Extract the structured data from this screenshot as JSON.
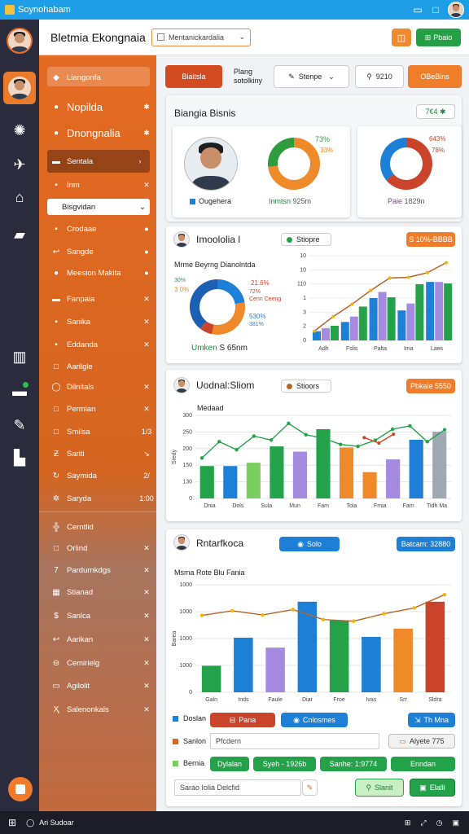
{
  "window": {
    "title": "Soynohabam",
    "icons": [
      "window-logo-icon",
      "minimize-icon",
      "maximize-icon",
      "avatar"
    ]
  },
  "rail": {
    "icons": [
      "avatar",
      "profile-active-icon",
      "globe-icon",
      "satellite-icon",
      "home-icon",
      "chat-icon",
      "barcode-icon",
      "inbox-icon",
      "wrench-icon",
      "analytics-icon",
      "record-icon"
    ]
  },
  "header": {
    "title": "Bletmia Ekongnaia",
    "select_value": "Mentanickardalia",
    "icon_name": "toggle-icon",
    "action_label": "Pbaio"
  },
  "sidebar": {
    "items": [
      {
        "icon": "◆",
        "label": "Liangonfa",
        "right": ""
      },
      {
        "icon": "●",
        "label": "Nopilda",
        "right": "✱"
      },
      {
        "icon": "●",
        "label": "Dnongnalia",
        "right": "✱"
      },
      {
        "icon": "▬",
        "label": "Sentala",
        "right": "›"
      },
      {
        "icon": "▪",
        "label": "Inm",
        "right": "✕"
      },
      {
        "icon": "",
        "label": "Bisgvidan",
        "right": "⌄"
      },
      {
        "icon": "▪",
        "label": "Crodaae",
        "right": "●"
      },
      {
        "icon": "↩",
        "label": "Sangde",
        "right": "●"
      },
      {
        "icon": "●",
        "label": "Meesion Makita",
        "right": "●"
      },
      {
        "icon": "▬",
        "label": "Fanpaia",
        "right": "✕"
      },
      {
        "icon": "▪",
        "label": "Sanika",
        "right": "✕"
      },
      {
        "icon": "▪",
        "label": "Eddanda",
        "right": "✕"
      },
      {
        "icon": "□",
        "label": "Aarilgle",
        "right": ""
      },
      {
        "icon": "◯",
        "label": "Dilnitals",
        "right": "✕"
      },
      {
        "icon": "□",
        "label": "Permian",
        "right": "✕"
      },
      {
        "icon": "□",
        "label": "Smilsa",
        "right": "1/3"
      },
      {
        "icon": "Ƶ",
        "label": "Sariti",
        "right": "↘"
      },
      {
        "icon": "↻",
        "label": "Saymida",
        "right": "2/"
      },
      {
        "icon": "✲",
        "label": "Saryda",
        "right": "1:00"
      },
      {
        "icon": "╬",
        "label": "Cerntlid",
        "right": ""
      },
      {
        "icon": "□",
        "label": "Orlind",
        "right": "✕"
      },
      {
        "icon": "7",
        "label": "Pardurnkdgs",
        "right": "✕"
      },
      {
        "icon": "▦",
        "label": "Stianad",
        "right": "✕"
      },
      {
        "icon": "$",
        "label": "Sanlca",
        "right": "✕"
      },
      {
        "icon": "↩",
        "label": "Aarikan",
        "right": "✕"
      },
      {
        "icon": "⊖",
        "label": "Cemirielg",
        "right": "✕"
      },
      {
        "icon": "▭",
        "label": "Agilolit",
        "right": "✕"
      },
      {
        "icon": "Ҳ",
        "label": "Salenonkals",
        "right": "✕"
      }
    ]
  },
  "toolbar": {
    "tab_active": "Biaitsla",
    "tab_two": "Plang\nsotolkiny",
    "pencil_label": "Stenpe",
    "search_value": "9210",
    "orange_btn": "OBeBins"
  },
  "overview": {
    "title": "Biangia Bisnis",
    "badge": "7€4 ✱",
    "profile_caption": "Ougehera",
    "donut1": {
      "caption": "Inmtsn",
      "value": "925m",
      "pct_a": "73%",
      "pct_b": "33%"
    },
    "donut2": {
      "caption": "Paie",
      "value": "1829n",
      "pct_a": "643%",
      "pct_b": "78%"
    }
  },
  "card1": {
    "title": "Imoololia l",
    "chip": "Stiopre",
    "orange_btn": "S 10%-BBBB",
    "subtitle": "Mrme Beyrng Dianolntda",
    "donut": {
      "caption": "Umken",
      "value": "S 65nm",
      "labels_left": [
        "30%",
        "3 0%"
      ],
      "labels_right": [
        "21.6%",
        "72%",
        "Cenn Ceeng",
        "530%",
        "381%"
      ]
    }
  },
  "card2": {
    "title": "Uodnal:Sliom",
    "chip": "Stioors",
    "orange_btn": "Pbkaie 5550",
    "subtitle": "Medaad"
  },
  "card3": {
    "title": "Rntarfkoca",
    "chip": "Solo",
    "blue_btn": "Batcam: 32880",
    "subtitle": "Msma Rote Blu Fania"
  },
  "bottom": {
    "row1": {
      "label": "Doslan",
      "a": "Pana",
      "b": "Cnlosmes",
      "c": "Th Mna"
    },
    "row2": {
      "label": "Sanlon",
      "field": "Pfcdern",
      "right": "Alyete 775"
    },
    "row3": {
      "label": "Bernia",
      "a": "Dylalan",
      "b": "Syeh - 1926b",
      "c": "Sanhe: 1:9774",
      "d": "Enndan"
    },
    "input": "Sarao Iolia Delcfid",
    "search": "Slanit",
    "edit": "Elalli"
  },
  "taskbar": {
    "text": "Ari Sudoar"
  },
  "colors": {
    "orange": "#ef7d2a",
    "blue": "#1e7fd6",
    "green": "#24a24a",
    "lightgreen": "#7ccd62",
    "purple": "#a58be0",
    "sky": "#2e97e6",
    "red": "#c9442a",
    "brownline": "#b86424"
  },
  "chart_data": [
    {
      "type": "donut",
      "values": [
        73,
        27
      ],
      "labels": [
        "73%",
        "33%"
      ],
      "colors": [
        "#ef8a2a",
        "#2e9b3e"
      ]
    },
    {
      "type": "donut",
      "values": [
        64,
        36
      ],
      "labels": [
        "643%",
        "78%"
      ],
      "colors": [
        "#c9442a",
        "#1e7fd6"
      ]
    },
    {
      "type": "donut",
      "values": [
        21.6,
        30,
        7.2,
        38.1
      ],
      "colors": [
        "#1e7fd6",
        "#ef8a2a",
        "#c9442a",
        "#1d5fb0"
      ]
    },
    {
      "type": "bar",
      "categories": [
        "Adh",
        "Fslis",
        "Palta",
        "Ima",
        "Laes"
      ],
      "series": [
        {
          "values": [
            1.2,
            2.4,
            5.5,
            3.9,
            7.6
          ],
          "color": "#1e7fd6"
        },
        {
          "values": [
            1.6,
            3.1,
            6.3,
            4.8,
            7.6
          ],
          "color": "#a58be0"
        },
        {
          "values": [
            1.9,
            4.4,
            5.6,
            7.3,
            7.4
          ],
          "color": "#24a24a"
        }
      ],
      "line": [
        1.2,
        3.1,
        4.7,
        6.5,
        8.1,
        8.2,
        8.8,
        10.1
      ],
      "yticks": [
        "0",
        "2",
        "3",
        "1",
        "110",
        "10",
        "10"
      ],
      "ylim": [
        0,
        11
      ]
    },
    {
      "type": "bar",
      "categories": [
        "Dnia",
        "Dols",
        "Sula",
        "Mun",
        "Fam",
        "Tola",
        "Fmia",
        "Fam",
        "Tidh Ma"
      ],
      "bars": [
        {
          "v": 117,
          "c": "#24a24a"
        },
        {
          "v": 117,
          "c": "#1e7fd6"
        },
        {
          "v": 129,
          "c": "#7ccd62"
        },
        {
          "v": 188,
          "c": "#24a24a"
        },
        {
          "v": 169,
          "c": "#a58be0"
        },
        {
          "v": 250,
          "c": "#24a24a"
        },
        {
          "v": 184,
          "c": "#ef8a2a"
        },
        {
          "v": 95,
          "c": "#ef8a2a"
        },
        {
          "v": 141,
          "c": "#a58be0"
        },
        {
          "v": 212,
          "c": "#1e7fd6"
        },
        {
          "v": 241,
          "c": "#a0a8b4"
        }
      ],
      "line": [
        146,
        205,
        176,
        225,
        211,
        271,
        230,
        218,
        195,
        188,
        210,
        250,
        262,
        205,
        248
      ],
      "line_color": "#24a24a",
      "line2": [
        220,
        200,
        232
      ],
      "line2_color": "#c9442a",
      "yticks": [
        "300",
        "250",
        "200",
        "150",
        "130",
        "0"
      ],
      "ylim": [
        0,
        300
      ],
      "ylabel": "Sredy"
    },
    {
      "type": "bar",
      "categories": [
        "Galn",
        "Inds",
        "Faule",
        "Diar",
        "Froe",
        "Ivas",
        "Srr",
        "Sldra"
      ],
      "bars": [
        {
          "v": 320,
          "c": "#24a24a"
        },
        {
          "v": 660,
          "c": "#1e7fd6"
        },
        {
          "v": 540,
          "c": "#a58be0"
        },
        {
          "v": 1095,
          "c": "#1e7fd6"
        },
        {
          "v": 870,
          "c": "#24a24a"
        },
        {
          "v": 670,
          "c": "#1e7fd6"
        },
        {
          "v": 770,
          "c": "#ef8a2a"
        },
        {
          "v": 1095,
          "c": "#c9442a"
        }
      ],
      "line": [
        930,
        985,
        935,
        1000,
        880,
        860,
        950,
        1020,
        1180
      ],
      "line_color": "#b86424",
      "line_dots": "#f4b400",
      "yticks": [
        "1000",
        "1000",
        "1000",
        "1000",
        "0"
      ],
      "ylim": [
        0,
        1300
      ],
      "ylabel": "Barea"
    }
  ]
}
